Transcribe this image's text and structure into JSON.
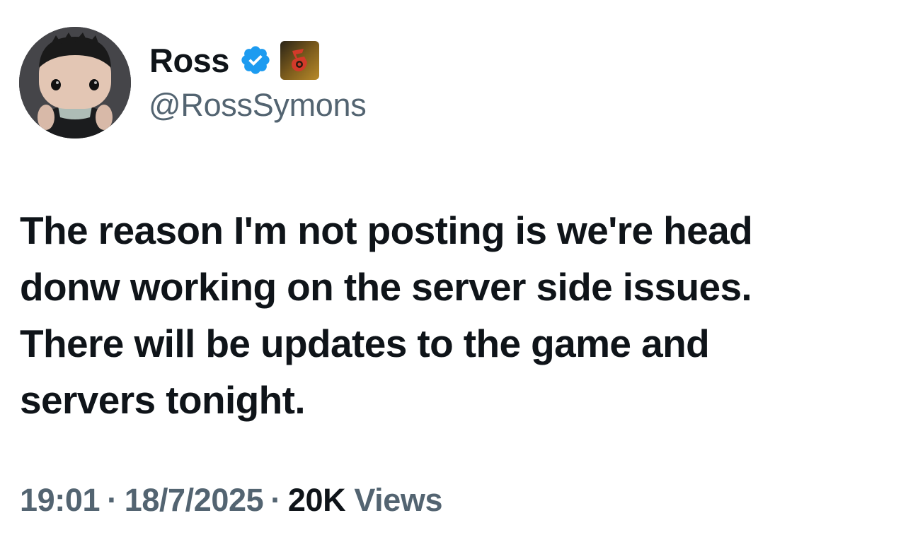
{
  "author": {
    "display_name": "Ross",
    "handle": "@RossSymons",
    "verified_badge_icon": "verified-checkmark-icon",
    "affiliate_badge_icon": "affiliate-badge-icon",
    "avatar_icon": "avatar-figurine"
  },
  "tweet": {
    "lines": [
      "The reason I'm not posting is we're head",
      "donw working on the server side issues.",
      "There will be updates to the game and",
      "servers tonight."
    ]
  },
  "meta": {
    "time": "19:01",
    "separator": "·",
    "date": "18/7/2025",
    "views_count": "20K",
    "views_label": "Views"
  },
  "colors": {
    "text_primary": "#0f1419",
    "text_secondary": "#536471",
    "verified_blue": "#1d9bf0",
    "affiliate_bg": "#8a6a1a",
    "affiliate_mark": "#d23a2a"
  }
}
